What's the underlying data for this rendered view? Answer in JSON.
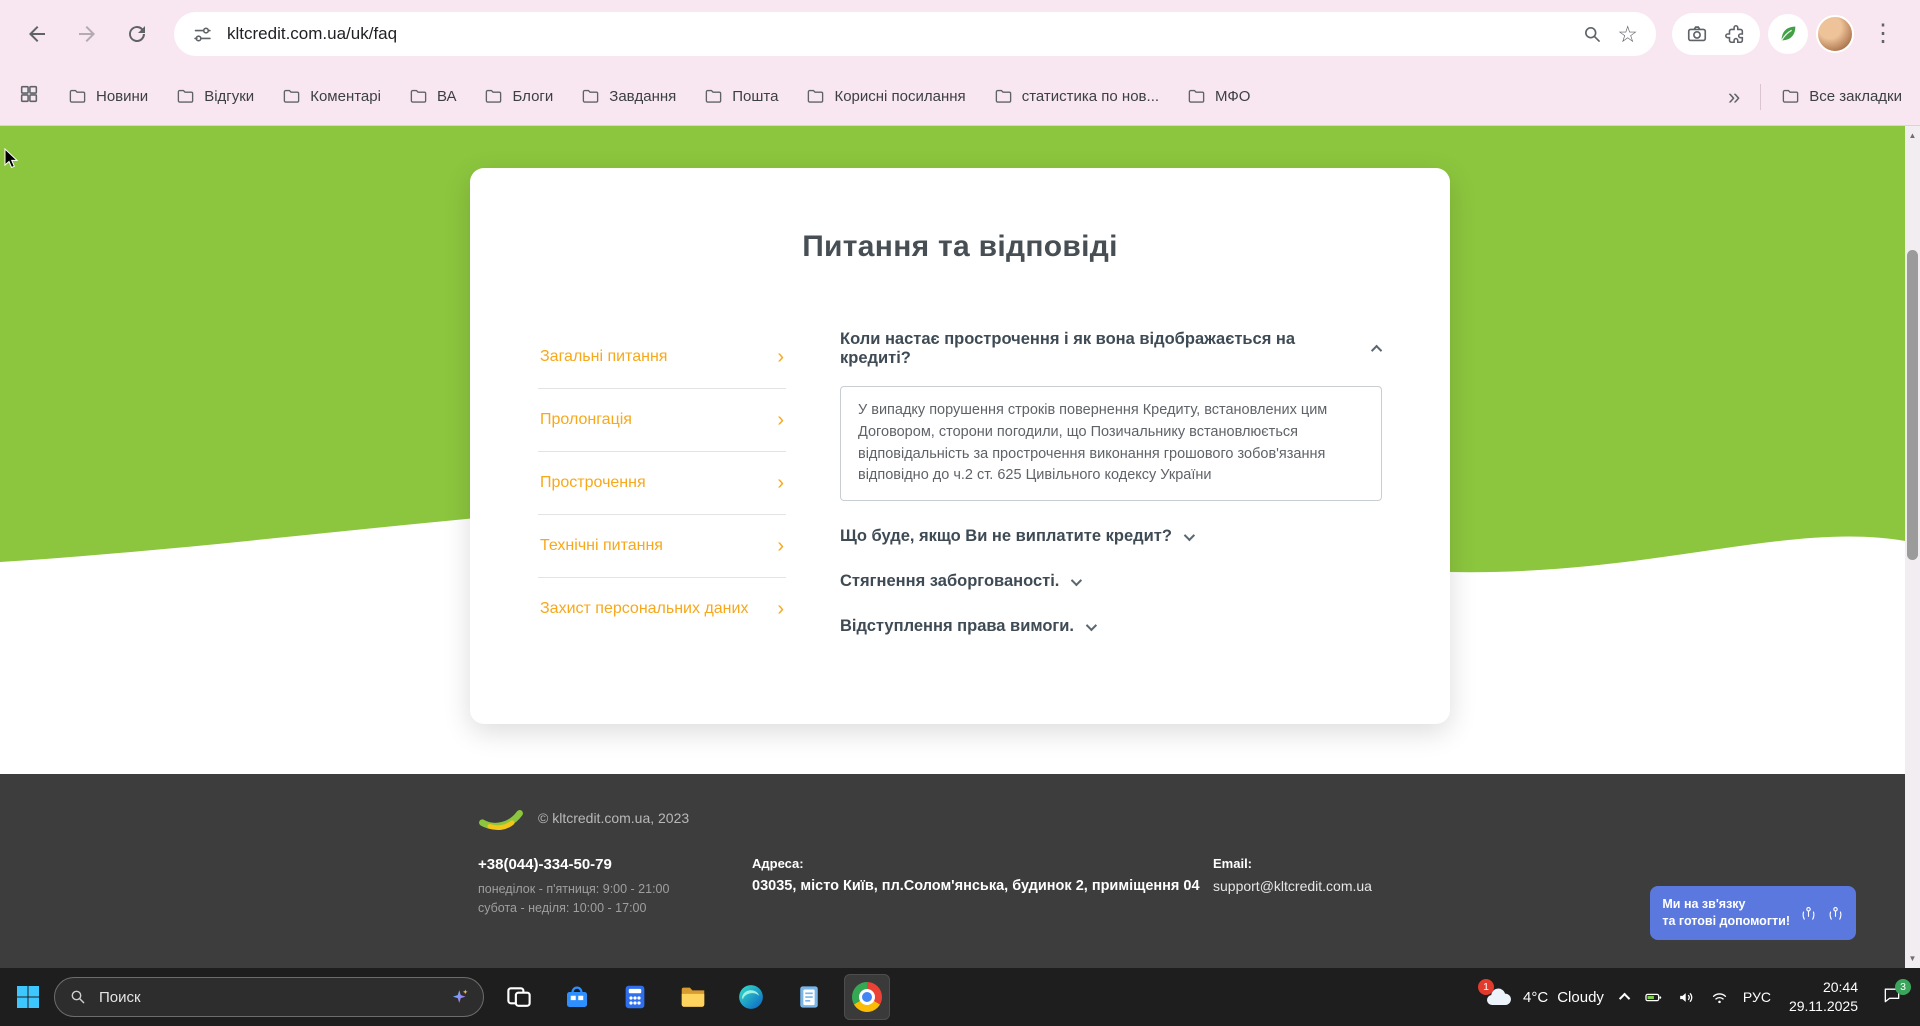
{
  "theme": {
    "brand_green": "#8cc63e",
    "link_orange": "#f7a81b",
    "footer_bg": "#3d3d3d",
    "chat_blue": "#5a78de",
    "browser_pink": "#f8e7f0"
  },
  "browser": {
    "url": "kltcredit.com.ua/uk/faq",
    "bookmarks": [
      "Новини",
      "Відгуки",
      "Коментарі",
      "ВА",
      "Блоги",
      "Завдання",
      "Пошта",
      "Корисні посилання",
      "статистика по нов...",
      "МФО"
    ],
    "bookmarks_overflow": "»",
    "all_bookmarks": "Все закладки"
  },
  "page": {
    "title": "Питання та відповіді",
    "menu": [
      "Загальні питання",
      "Пролонгація",
      "Прострочення",
      "Технічні питання",
      "Захист персональних даних"
    ],
    "faq": [
      {
        "q": "Коли настає прострочення і як вона відображається на кредиті?",
        "answer": "У випадку порушення строків повернення Кредиту, встановлених цим Договором, сторони погодили, що Позичальнику встановлюється відповідальність за прострочення виконання грошового зобов'язання відповідно до ч.2 ст. 625 Цивільного кодексу України"
      },
      {
        "q": "Що буде, якщо Ви не виплатите кредит?"
      },
      {
        "q": "Стягнення заборгованості."
      },
      {
        "q": "Відступлення права вимоги."
      }
    ],
    "footer": {
      "copyright": "© kltcredit.com.ua, 2023",
      "phone": "+38(044)-334-50-79",
      "hours_weekdays": "понеділок - п'ятниця: 9:00 - 21:00",
      "hours_weekend": "субота - неділя: 10:00 - 17:00",
      "address_label": "Адреса:",
      "address": "03035, місто Київ, пл.Солом'янська, будинок 2, приміщення 04",
      "email_label": "Email:",
      "email": "support@kltcredit.com.ua",
      "chat_line1": "Ми на зв'язку",
      "chat_line2": "та готові допомогти!"
    }
  },
  "taskbar": {
    "search_placeholder": "Поиск",
    "weather_temp": "4°C",
    "weather_label": "Cloudy",
    "weather_badge": "1",
    "language": "РУС",
    "time": "20:44",
    "date": "29.11.2025",
    "notifications_badge": "3"
  }
}
